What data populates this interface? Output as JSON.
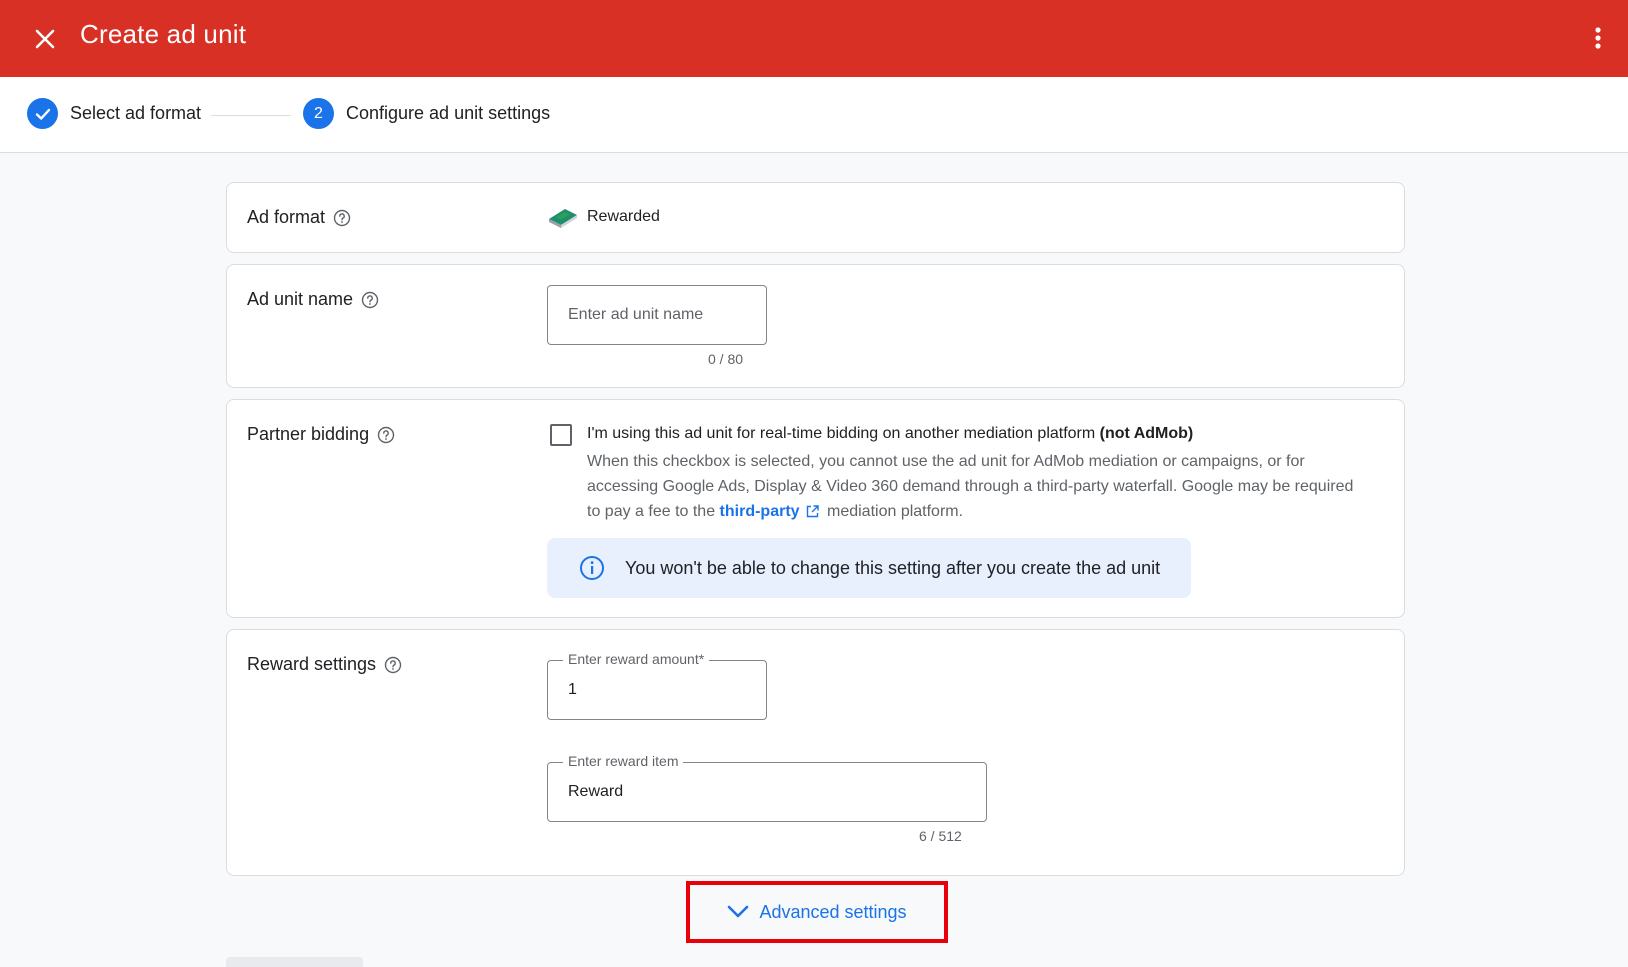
{
  "header": {
    "title": "Create ad unit",
    "close_icon": "close-icon",
    "more_icon": "more-vert-icon"
  },
  "stepper": {
    "steps": [
      {
        "label": "Select ad format",
        "state": "completed"
      },
      {
        "label": "Configure ad unit settings",
        "state": "active",
        "number": "2"
      }
    ]
  },
  "ad_format": {
    "label": "Ad format",
    "value": "Rewarded"
  },
  "ad_unit_name": {
    "label": "Ad unit name",
    "placeholder": "Enter ad unit name",
    "value": "",
    "counter": "0 / 80"
  },
  "partner_bidding": {
    "label": "Partner bidding",
    "checked": false,
    "checkbox_text": "I'm using this ad unit for real-time bidding on another mediation platform ",
    "checkbox_bold": "(not AdMob)",
    "desc_before": "When this checkbox is selected, you cannot use the ad unit for AdMob mediation or campaigns, or for accessing Google Ads, Display & Video 360 demand through a third-party waterfall. Google may be required to pay a fee to the ",
    "link_text": "third-party",
    "desc_after": " mediation platform.",
    "info_text": "You won't be able to change this setting after you create the ad unit"
  },
  "reward_settings": {
    "label": "Reward settings",
    "amount_label": "Enter reward amount*",
    "amount_value": "1",
    "item_label": "Enter reward item",
    "item_value": "Reward",
    "item_counter": "6 / 512"
  },
  "advanced": {
    "label": "Advanced settings"
  },
  "colors": {
    "header_bg": "#d93025",
    "accent": "#1a73e8",
    "highlight_border": "#e8000b",
    "info_bg": "#e8f0fe"
  }
}
